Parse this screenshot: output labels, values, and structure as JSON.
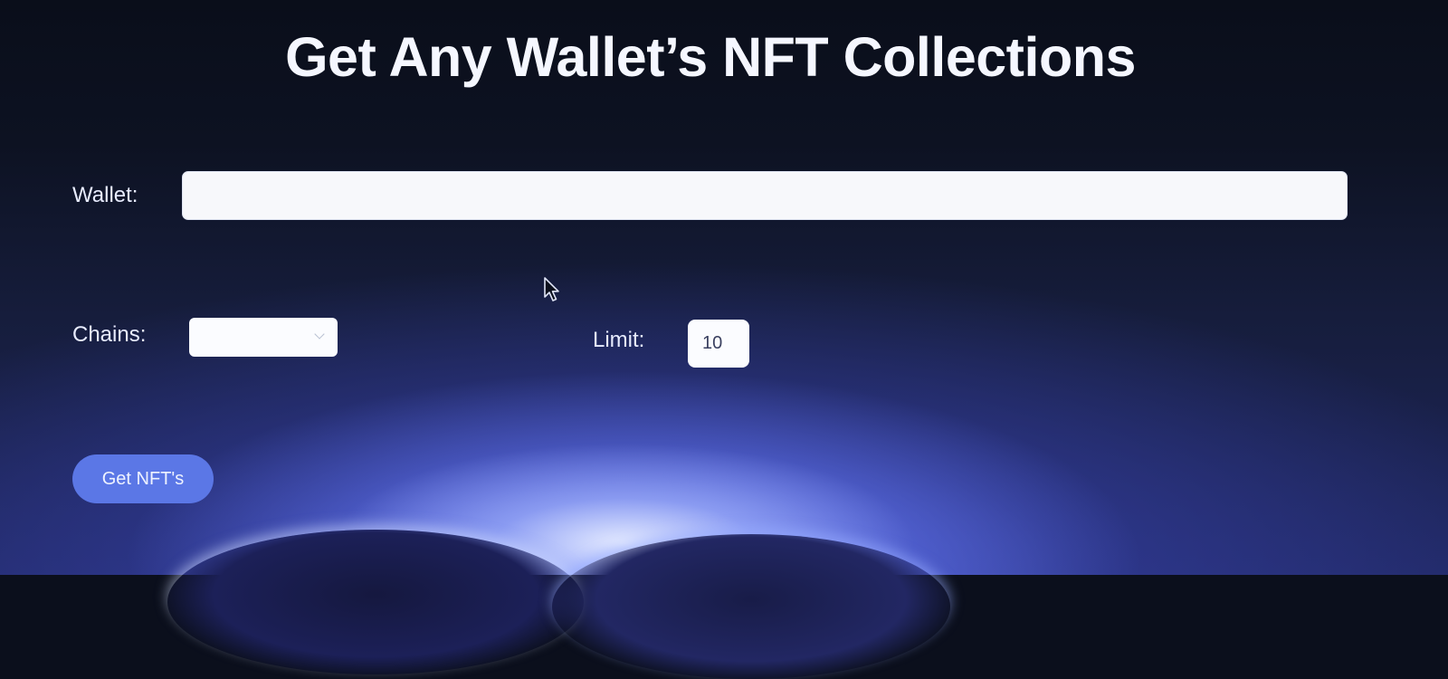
{
  "header": {
    "title": "Get Any Wallet’s NFT Collections"
  },
  "form": {
    "wallet": {
      "label": "Wallet:",
      "value": ""
    },
    "chains": {
      "label": "Chains:",
      "selected": ""
    },
    "limit": {
      "label": "Limit:",
      "value": "10"
    },
    "submit_label": "Get NFT's"
  },
  "colors": {
    "background": "#0b0f1c",
    "accent_button": "#5b77e6",
    "input_bg": "#f7f8fb",
    "text_light": "#f5f7ff"
  },
  "icons": {
    "chains_dropdown": "chevron-down-icon",
    "pointer": "mouse-cursor-icon"
  }
}
